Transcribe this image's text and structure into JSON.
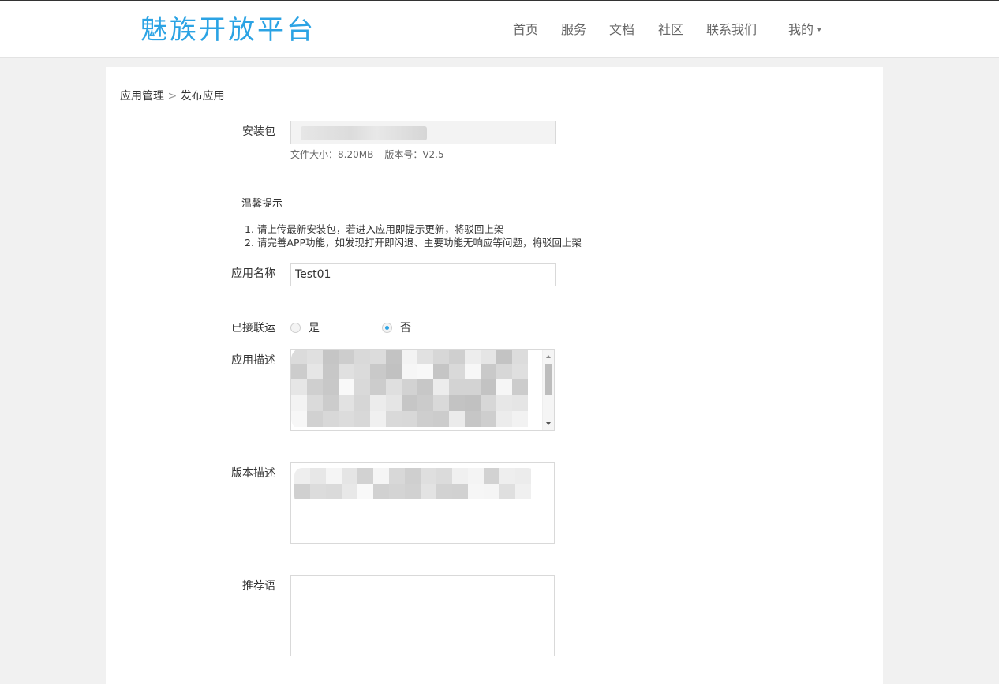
{
  "header": {
    "logo": "魅族开放平台",
    "nav": [
      "首页",
      "服务",
      "文档",
      "社区",
      "联系我们"
    ],
    "account_label": "我的"
  },
  "breadcrumb": {
    "parent": "应用管理",
    "separator": ">",
    "current": "发布应用"
  },
  "form": {
    "package_label": "安装包",
    "file_size": "文件大小：8.20MB",
    "version": "版本号：V2.5",
    "tips_title": "温馨提示",
    "tips": [
      "1. 请上传最新安装包，若进入应用即提示更新，将驳回上架",
      "2. 请完善APP功能，如发现打开即闪退、主要功能无响应等问题，将驳回上架"
    ],
    "app_name_label": "应用名称",
    "app_name_value": "Test01",
    "linked_label": "已接联运",
    "linked_options": [
      "是",
      "否"
    ],
    "linked_selected": "否",
    "app_desc_label": "应用描述",
    "version_desc_label": "版本描述",
    "recommend_label": "推荐语"
  },
  "colors": {
    "brand": "#2ba3e4",
    "page_bg": "#f1f1f1"
  }
}
